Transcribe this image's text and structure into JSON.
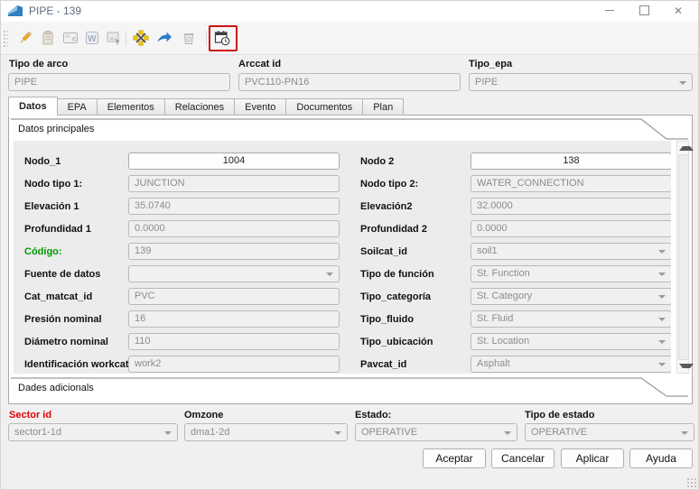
{
  "window": {
    "title": "PIPE - 139",
    "controls": {
      "minimize": "minimize-icon",
      "maximize": "maximize-icon",
      "close_glyph": "✕"
    }
  },
  "toolbar": {
    "icons": [
      {
        "name": "edit-icon",
        "enabled": true
      },
      {
        "name": "paste-icon",
        "enabled": false
      },
      {
        "name": "catalog-icon",
        "enabled": false
      },
      {
        "name": "word-export-icon",
        "enabled": false
      },
      {
        "name": "snapshot-icon",
        "enabled": false
      },
      {
        "name": "move-node-icon",
        "enabled": true
      },
      {
        "name": "flow-direction-icon",
        "enabled": true
      },
      {
        "name": "delete-icon",
        "enabled": false
      },
      {
        "name": "date-clock-icon",
        "enabled": true,
        "highlighted": true
      }
    ],
    "highlight_color": "#cf1010"
  },
  "header_fields": {
    "arc_type": {
      "label": "Tipo de arco",
      "value": "PIPE"
    },
    "arccat_id": {
      "label": "Arccat id",
      "value": "PVC110-PN16"
    },
    "epa_type": {
      "label": "Tipo_epa",
      "value": "PIPE"
    }
  },
  "tabs": [
    {
      "label": "Datos"
    },
    {
      "label": "EPA"
    },
    {
      "label": "Elementos"
    },
    {
      "label": "Relaciones"
    },
    {
      "label": "Evento"
    },
    {
      "label": "Documentos"
    },
    {
      "label": "Plan"
    }
  ],
  "sections": {
    "main": "Datos principales",
    "additional": "Dades adicionals"
  },
  "rows": [
    {
      "left": {
        "label": "Nodo_1",
        "value": "1004"
      },
      "right": {
        "label": "Nodo 2",
        "value": "138"
      }
    },
    {
      "left": {
        "label": "Nodo tipo 1:",
        "value": "JUNCTION"
      },
      "right": {
        "label": "Nodo tipo 2:",
        "value": "WATER_CONNECTION"
      }
    },
    {
      "left": {
        "label": "Elevación 1",
        "value": "35.0740"
      },
      "right": {
        "label": "Elevación2",
        "value": "32.0000"
      }
    },
    {
      "left": {
        "label": "Profundidad 1",
        "value": "0.0000"
      },
      "right": {
        "label": "Profundidad 2",
        "value": "0.0000"
      }
    },
    {
      "left": {
        "label": "Código:",
        "value": "139"
      },
      "right": {
        "label": "Soilcat_id",
        "value": "soil1"
      }
    },
    {
      "left": {
        "label": "Fuente de datos",
        "value": ""
      },
      "right": {
        "label": "Tipo de función",
        "value": "St. Function"
      }
    },
    {
      "left": {
        "label": "Cat_matcat_id",
        "value": "PVC"
      },
      "right": {
        "label": "Tipo_categoría",
        "value": "St. Category"
      }
    },
    {
      "left": {
        "label": "Presión nominal",
        "value": "16"
      },
      "right": {
        "label": "Tipo_fluido",
        "value": "St. Fluid"
      }
    },
    {
      "left": {
        "label": "Diámetro nominal",
        "value": "110"
      },
      "right": {
        "label": "Tipo_ubicación",
        "value": "St. Location"
      }
    },
    {
      "left": {
        "label": "Identificación workcat",
        "value": "work2"
      },
      "right": {
        "label": "Pavcat_id",
        "value": "Asphalt"
      }
    }
  ],
  "footer_fields": [
    {
      "label": "Sector id",
      "value": "sector1-1d"
    },
    {
      "label": "Omzone",
      "value": "dma1-2d"
    },
    {
      "label": "Estado:",
      "value": "OPERATIVE"
    },
    {
      "label": "Tipo de estado",
      "value": "OPERATIVE"
    }
  ],
  "buttons": {
    "accept": "Aceptar",
    "cancel": "Cancelar",
    "apply": "Aplicar",
    "help": "Ayuda"
  },
  "colors": {
    "code_label_green": "#009900",
    "sector_label_red": "#e60000",
    "logo_blue": "#2f7fc1"
  }
}
